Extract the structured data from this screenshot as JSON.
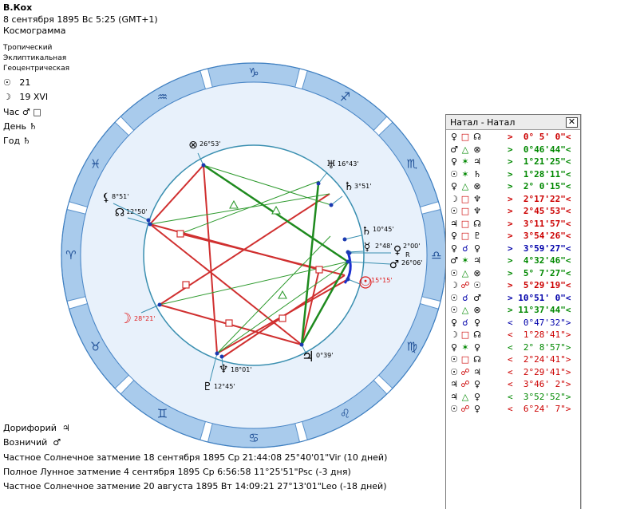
{
  "header": {
    "name": "В.Кох",
    "datetime": "8 сентября 1895  Вс  5:25 (GMT+1)",
    "chart_type": "Космограмма",
    "zodiac": "Тропический",
    "coordinates": "Эклиптикальная",
    "center": "Геоцентрическая",
    "sun_value": "21",
    "moon_value": "19 XVI",
    "hour_label": "Час",
    "hour_symbols": "♂ □",
    "day_label": "День",
    "day_symbol": "♄",
    "year_label": "Год",
    "year_symbol": "♄"
  },
  "wheel": {
    "signs": [
      "♑",
      "♐",
      "♏",
      "♎",
      "♍",
      "♌",
      "♋",
      "♊",
      "♉",
      "♈",
      "♓",
      "♒"
    ],
    "planets": [
      {
        "name": "moon",
        "glyph": "☽",
        "deg": "28°21'",
        "color": "#e02020"
      },
      {
        "name": "sun",
        "glyph": "☉",
        "deg": "15°15'",
        "color": "#e02020"
      },
      {
        "name": "mars",
        "glyph": "♂",
        "deg": "26°06'",
        "color": "#000000"
      },
      {
        "name": "venus",
        "glyph": "♀",
        "deg": "2°00'",
        "color": "#000000"
      },
      {
        "name": "venus-r",
        "glyph": "R",
        "deg": "",
        "color": "#000000"
      },
      {
        "name": "mercury",
        "glyph": "☿",
        "deg": "2°48'",
        "color": "#000000"
      },
      {
        "name": "saturn",
        "glyph": "♄",
        "deg": "10°45'",
        "color": "#000000"
      },
      {
        "name": "jupiter",
        "glyph": "♃",
        "deg": "0°39'",
        "color": "#000000"
      },
      {
        "name": "neptune",
        "glyph": "♆",
        "deg": "18°01'",
        "color": "#000000"
      },
      {
        "name": "pluto",
        "glyph": "♇",
        "deg": "12°45'",
        "color": "#000000"
      },
      {
        "name": "node",
        "glyph": "☊",
        "deg": "12°50'",
        "color": "#000000"
      },
      {
        "name": "lilith",
        "glyph": "⚸",
        "deg": "8°51'",
        "color": "#000000"
      },
      {
        "name": "fortune",
        "glyph": "⊗",
        "deg": "26°53'",
        "color": "#000000"
      },
      {
        "name": "uranus",
        "glyph": "♅",
        "deg": "16°43'",
        "color": "#000000"
      },
      {
        "name": "chiron",
        "glyph": "♄",
        "deg": "3°51'",
        "color": "#000000"
      }
    ]
  },
  "footer": {
    "doriphory_label": "Дорифорий",
    "doriphory_symbol": "♃",
    "charioteer_label": "Возничий",
    "charioteer_symbol": "♂",
    "eclipse1": "Частное Солнечное затмение 18 сентября 1895 Ср 21:44:08 25°40'01\"Vir (10 дней)",
    "eclipse2": "Полное Лунное затмение 4 сентября 1895 Ср  6:56:58 11°25'51\"Psc (-3 дня)",
    "eclipse3": "Частное Солнечное затмение 20 августа 1895 Вт 14:09:21 27°13'01\"Leo (-18 дней)"
  },
  "panel": {
    "title": "Натал - Натал",
    "close": "✕",
    "colors": {
      "red": "#cc0000",
      "green": "#008800",
      "blue": "#0000aa"
    },
    "rows": [
      {
        "p1": "♀",
        "asp": "□",
        "p2": "☊",
        "val": ">  0° 5' 0\"<",
        "color": "red",
        "bold": true
      },
      {
        "p1": "♂",
        "asp": "△",
        "p2": "⊗",
        "val": ">  0°46'44\"<",
        "color": "green",
        "bold": true
      },
      {
        "p1": "♀",
        "asp": "✶",
        "p2": "♃",
        "val": ">  1°21'25\"<",
        "color": "green",
        "bold": true
      },
      {
        "p1": "☉",
        "asp": "✶",
        "p2": "♄",
        "val": ">  1°28'11\"<",
        "color": "green",
        "bold": true
      },
      {
        "p1": "♀",
        "asp": "△",
        "p2": "⊗",
        "val": ">  2° 0'15\"<",
        "color": "green",
        "bold": true
      },
      {
        "p1": "☽",
        "asp": "□",
        "p2": "♆",
        "val": ">  2°17'22\"<",
        "color": "red",
        "bold": true
      },
      {
        "p1": "☉",
        "asp": "□",
        "p2": "♆",
        "val": ">  2°45'53\"<",
        "color": "red",
        "bold": true
      },
      {
        "p1": "♃",
        "asp": "□",
        "p2": "☊",
        "val": ">  3°11'57\"<",
        "color": "red",
        "bold": true
      },
      {
        "p1": "♀",
        "asp": "□",
        "p2": "♇",
        "val": ">  3°54'26\"<",
        "color": "red",
        "bold": true
      },
      {
        "p1": "♀",
        "asp": "☌",
        "p2": "♀",
        "val": ">  3°59'27\"<",
        "color": "blue",
        "bold": true
      },
      {
        "p1": "♂",
        "asp": "✶",
        "p2": "♃",
        "val": ">  4°32'46\"<",
        "color": "green",
        "bold": true
      },
      {
        "p1": "☉",
        "asp": "△",
        "p2": "⊗",
        "val": ">  5° 7'27\"<",
        "color": "green",
        "bold": true
      },
      {
        "p1": "☽",
        "asp": "☍",
        "p2": "☉",
        "val": ">  5°29'19\"<",
        "color": "red",
        "bold": true
      },
      {
        "p1": "☉",
        "asp": "☌",
        "p2": "♂",
        "val": "> 10°51' 0\"<",
        "color": "blue",
        "bold": true
      },
      {
        "p1": "☉",
        "asp": "△",
        "p2": "⊗",
        "val": "> 11°37'44\"<",
        "color": "green",
        "bold": true
      },
      {
        "p1": "♀",
        "asp": "☌",
        "p2": "♀",
        "val": "<  0°47'32\">",
        "color": "blue",
        "bold": false
      },
      {
        "p1": "☽",
        "asp": "□",
        "p2": "☊",
        "val": "<  1°28'41\">",
        "color": "red",
        "bold": false
      },
      {
        "p1": "♀",
        "asp": "✶",
        "p2": "♀",
        "val": "<  2° 8'57\">",
        "color": "green",
        "bold": false
      },
      {
        "p1": "☉",
        "asp": "□",
        "p2": "☊",
        "val": "<  2°24'41\">",
        "color": "red",
        "bold": false
      },
      {
        "p1": "☉",
        "asp": "☍",
        "p2": "♃",
        "val": "<  2°29'41\">",
        "color": "red",
        "bold": false
      },
      {
        "p1": "♃",
        "asp": "☍",
        "p2": "♀",
        "val": "<  3°46' 2\">",
        "color": "red",
        "bold": false
      },
      {
        "p1": "♃",
        "asp": "△",
        "p2": "♀",
        "val": "<  3°52'52\">",
        "color": "green",
        "bold": false
      },
      {
        "p1": "☉",
        "asp": "☍",
        "p2": "♀",
        "val": "<  6°24' 7\">",
        "color": "red",
        "bold": false
      }
    ]
  }
}
